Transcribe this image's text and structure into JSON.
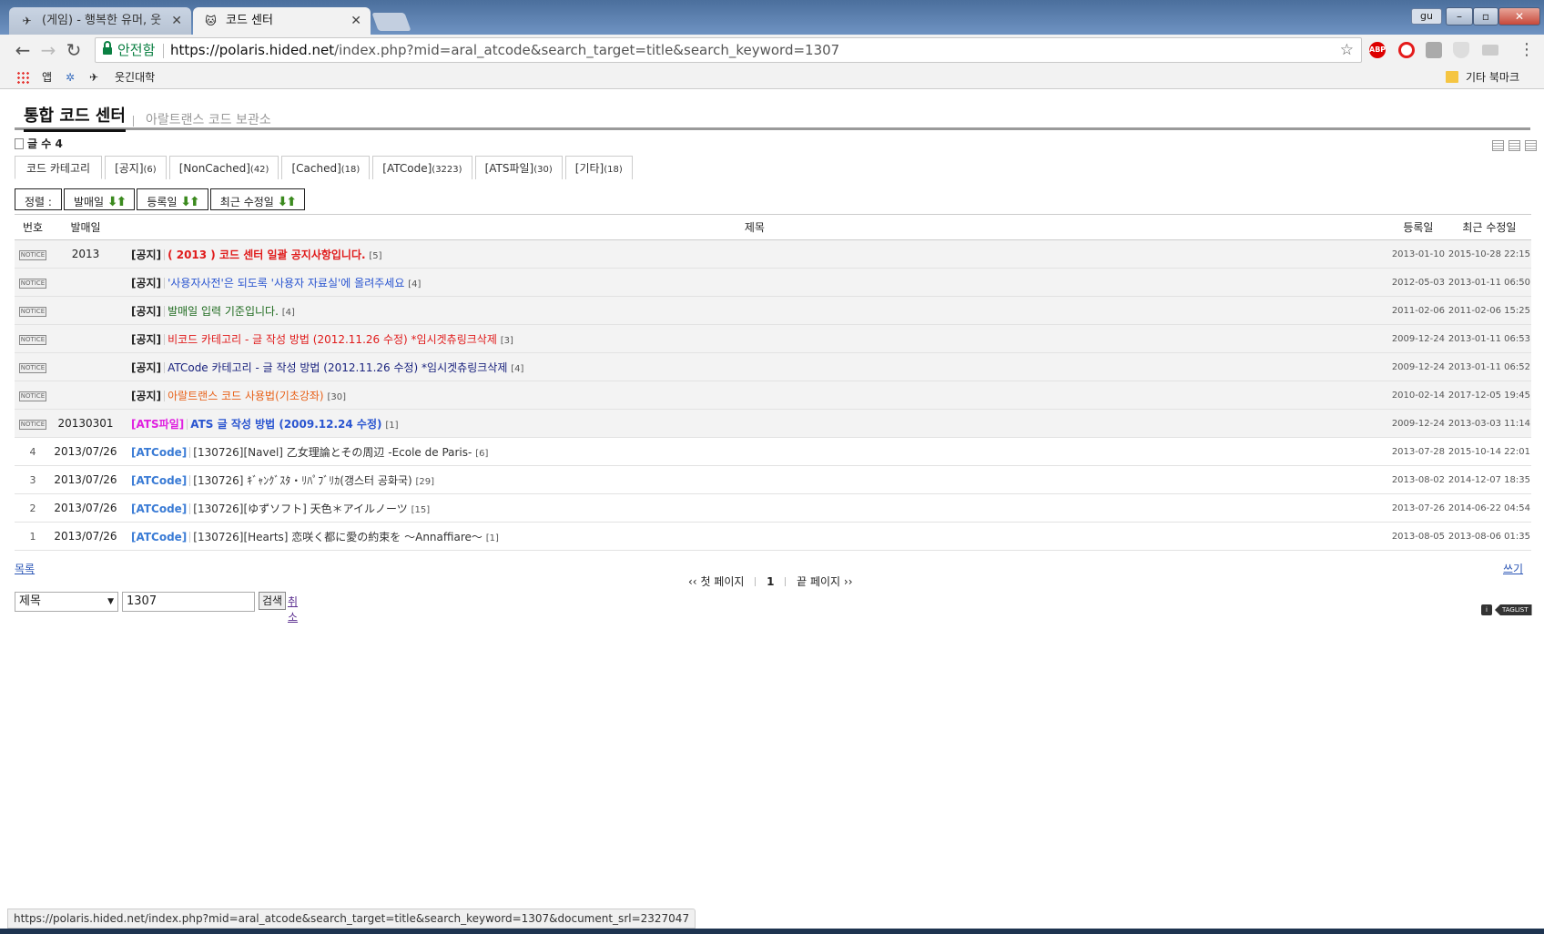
{
  "browser": {
    "tabs": [
      {
        "title": "(게임) - 행복한 유머, 웃",
        "active": false
      },
      {
        "title": "코드 센터",
        "active": true
      }
    ],
    "profile": "gu",
    "omnibox": {
      "secure_label": "안전함",
      "url_scheme_host": "https://polaris.hided.net",
      "url_path": "/index.php?mid=aral_atcode&search_target=title&search_keyword=1307"
    },
    "extensions": [
      "ABP",
      "opera-icon",
      "ext-icon",
      "shield-icon",
      "cast-icon"
    ],
    "bookmarks": {
      "apps": "앱",
      "items": [
        "웃긴대학"
      ],
      "other": "기타 북마크"
    },
    "status_url": "https://polaris.hided.net/index.php?mid=aral_atcode&search_target=title&search_keyword=1307&document_srl=2327047"
  },
  "header": {
    "title": "통합 코드 센터",
    "subtitle": "아랄트랜스 코드 보관소"
  },
  "post_count": {
    "label": "글 수",
    "value": "4"
  },
  "categories": [
    {
      "label": "코드 카테고리",
      "count": ""
    },
    {
      "label": "[공지]",
      "count": "(6)"
    },
    {
      "label": "[NonCached]",
      "count": "(42)"
    },
    {
      "label": "[Cached]",
      "count": "(18)"
    },
    {
      "label": "[ATCode]",
      "count": "(3223)"
    },
    {
      "label": "[ATS파일]",
      "count": "(30)"
    },
    {
      "label": "[기타]",
      "count": "(18)"
    }
  ],
  "sort": {
    "label": "정렬 :",
    "items": [
      "발매일",
      "등록일",
      "최근 수정일"
    ]
  },
  "table": {
    "headers": {
      "no": "번호",
      "release": "발매일",
      "title": "제목",
      "reg": "등록일",
      "mod": "최근 수정일"
    },
    "notice_badge": "NOTICE",
    "rows": [
      {
        "no": "",
        "notice": true,
        "release": "2013",
        "cat": "[공지]",
        "cat_color": "#222222",
        "title": "( 2013 ) 코드 센터 일괄 공지사항입니다.",
        "title_color": "#e01b1b",
        "bold": true,
        "comments": "[5]",
        "reg": "2013-01-10",
        "mod": "2015-10-28 22:15"
      },
      {
        "no": "",
        "notice": true,
        "release": "",
        "cat": "[공지]",
        "cat_color": "#222222",
        "title": "'사용자사전'은 되도록 '사용자 자료실'에 올려주세요",
        "title_color": "#2a55d0",
        "bold": false,
        "comments": "[4]",
        "reg": "2012-05-03",
        "mod": "2013-01-11 06:50"
      },
      {
        "no": "",
        "notice": true,
        "release": "",
        "cat": "[공지]",
        "cat_color": "#222222",
        "title": "발매일 입력 기준입니다.",
        "title_color": "#1e6a1e",
        "bold": false,
        "comments": "[4]",
        "reg": "2011-02-06",
        "mod": "2011-02-06 15:25"
      },
      {
        "no": "",
        "notice": true,
        "release": "",
        "cat": "[공지]",
        "cat_color": "#222222",
        "title": "비코드 카테고리 - 글 작성 방법 (2012.11.26 수정) *임시겟츄링크삭제",
        "title_color": "#e01b1b",
        "bold": false,
        "comments": "[3]",
        "reg": "2009-12-24",
        "mod": "2013-01-11 06:53"
      },
      {
        "no": "",
        "notice": true,
        "release": "",
        "cat": "[공지]",
        "cat_color": "#222222",
        "title": "ATCode 카테고리 - 글 작성 방법 (2012.11.26 수정) *임시겟츄링크삭제",
        "title_color": "#1a237e",
        "bold": false,
        "comments": "[4]",
        "reg": "2009-12-24",
        "mod": "2013-01-11 06:52"
      },
      {
        "no": "",
        "notice": true,
        "release": "",
        "cat": "[공지]",
        "cat_color": "#222222",
        "title": "아랄트랜스 코드 사용법(기초강좌)",
        "title_color": "#e8621a",
        "bold": false,
        "comments": "[30]",
        "reg": "2010-02-14",
        "mod": "2017-12-05 19:45"
      },
      {
        "no": "",
        "notice": true,
        "release": "20130301",
        "cat": "[ATS파일]",
        "cat_color": "#e020e0",
        "title": "ATS 글 작성 방법 (2009.12.24 수정)",
        "title_color": "#2a55d0",
        "bold": true,
        "comments": "[1]",
        "reg": "2009-12-24",
        "mod": "2013-03-03 11:14"
      },
      {
        "no": "4",
        "notice": false,
        "release": "2013/07/26",
        "cat": "[ATCode]",
        "cat_color": "#3a7bd5",
        "title": "[130726][Navel] 乙女理論とその周辺 -Ecole de Paris-",
        "title_color": "#333333",
        "bold": false,
        "comments": "[6]",
        "reg": "2013-07-28",
        "mod": "2015-10-14 22:01"
      },
      {
        "no": "3",
        "notice": false,
        "release": "2013/07/26",
        "cat": "[ATCode]",
        "cat_color": "#3a7bd5",
        "title": "[130726] ｷﾞｬﾝｸﾞｽﾀ・ﾘﾊﾟﾌﾞﾘｶ(갱스터 공화국)",
        "title_color": "#333333",
        "bold": false,
        "comments": "[29]",
        "reg": "2013-08-02",
        "mod": "2014-12-07 18:35"
      },
      {
        "no": "2",
        "notice": false,
        "release": "2013/07/26",
        "cat": "[ATCode]",
        "cat_color": "#3a7bd5",
        "title": "[130726][ゆずソフト] 天色＊アイルノーツ",
        "title_color": "#333333",
        "bold": false,
        "comments": "[15]",
        "reg": "2013-07-26",
        "mod": "2014-06-22 04:54"
      },
      {
        "no": "1",
        "notice": false,
        "release": "2013/07/26",
        "cat": "[ATCode]",
        "cat_color": "#3a7bd5",
        "title": "[130726][Hearts] 恋咲く都に愛の約束を ～Annaffiare～",
        "title_color": "#333333",
        "bold": false,
        "comments": "[1]",
        "reg": "2013-08-05",
        "mod": "2013-08-06 01:35"
      }
    ]
  },
  "footer": {
    "list_link": "목록",
    "write_link": "쓰기",
    "pager": {
      "first": "첫 페이지",
      "current": "1",
      "last": "끝 페이지"
    },
    "search": {
      "target": "제목",
      "keyword": "1307",
      "button": "검색",
      "cancel": "취소"
    },
    "taglist": "TAGLIST"
  }
}
